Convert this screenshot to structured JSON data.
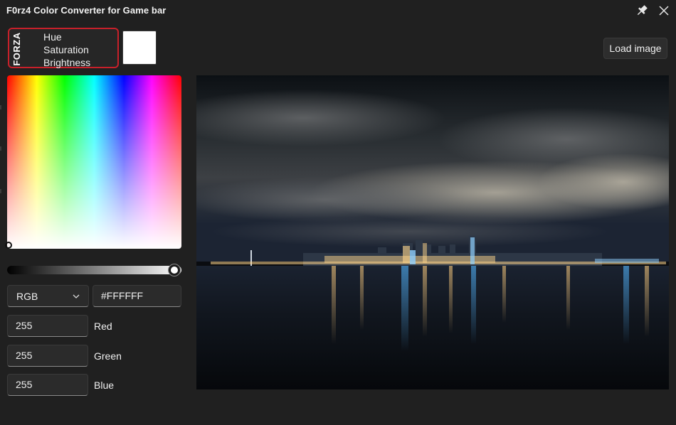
{
  "window": {
    "title": "F0rz4 Color Converter for Game bar",
    "pin_icon": "pin-icon",
    "close_icon": "close-icon"
  },
  "badge": {
    "logo_text": "FORZA",
    "lines": [
      "Hue",
      "Saturation",
      "Brightness"
    ],
    "border_color": "#c8202a"
  },
  "preview": {
    "color": "#FFFFFF"
  },
  "toolbar": {
    "load_image_label": "Load image"
  },
  "picker": {
    "brightness": 1.0
  },
  "mode_select": {
    "selected": "RGB"
  },
  "hex": {
    "value": "#FFFFFF"
  },
  "channels": [
    {
      "value": "255",
      "label": "Red"
    },
    {
      "value": "255",
      "label": "Green"
    },
    {
      "value": "255",
      "label": "Blue"
    }
  ],
  "image": {
    "subject": "night-city-skyline-over-water"
  }
}
